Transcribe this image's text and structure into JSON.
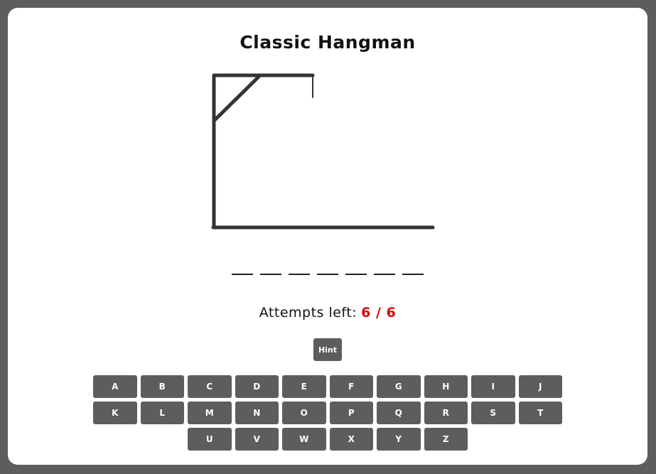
{
  "game": {
    "title": "Classic Hangman",
    "attempts_label": "Attempts left:",
    "attempts_value": "6 / 6",
    "hint_label": "Hint"
  },
  "word": {
    "slots": [
      "",
      "",
      "",
      "",
      "",
      "",
      ""
    ]
  },
  "keyboard": {
    "row1": [
      "A",
      "B",
      "C",
      "D",
      "E",
      "F",
      "G",
      "H",
      "I",
      "J"
    ],
    "row2": [
      "K",
      "L",
      "M",
      "N",
      "O",
      "P",
      "Q",
      "R",
      "S",
      "T"
    ],
    "row3": [
      "U",
      "V",
      "W",
      "X",
      "Y",
      "Z"
    ]
  },
  "colors": {
    "frame": "#5d5d5d",
    "card": "#ffffff",
    "gallows": "#333333",
    "attempts_accent": "#e00000",
    "key_bg": "#5d5d5d",
    "key_text": "#ffffff"
  }
}
